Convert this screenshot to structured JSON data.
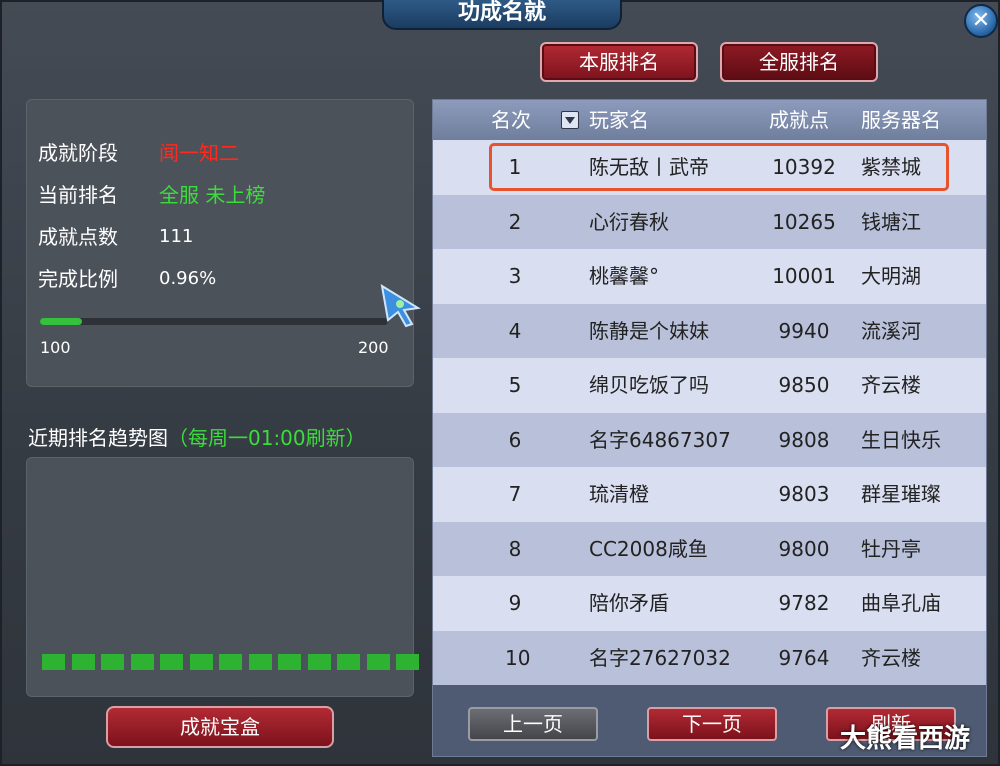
{
  "window": {
    "title": "功成名就",
    "close": "✕"
  },
  "tabs": {
    "server_rank": "本服排名",
    "all_rank": "全服排名"
  },
  "info": {
    "stage_label": "成就阶段",
    "stage_value": "闻一知二",
    "rank_label": "当前排名",
    "rank_value": "全服 未上榜",
    "points_label": "成就点数",
    "points_value": "111",
    "ratio_label": "完成比例",
    "ratio_value": "0.96%",
    "progress_fraction": 0.12,
    "scale_min": "100",
    "scale_max": "200"
  },
  "trend": {
    "title": "近期排名趋势图",
    "note": "（每周一01:00刷新）",
    "bar_count": 13
  },
  "table": {
    "headers": {
      "rank": "名次",
      "player": "玩家名",
      "points": "成就点",
      "server": "服务器名"
    },
    "rows": [
      {
        "rank": "1",
        "player": "陈无敌丨武帝",
        "points": "10392",
        "server": "紫禁城"
      },
      {
        "rank": "2",
        "player": "心衍春秋",
        "points": "10265",
        "server": "钱塘江"
      },
      {
        "rank": "3",
        "player": "桃馨馨°",
        "points": "10001",
        "server": "大明湖"
      },
      {
        "rank": "4",
        "player": "陈静是个妹妹",
        "points": "9940",
        "server": "流溪河"
      },
      {
        "rank": "5",
        "player": "绵贝吃饭了吗",
        "points": "9850",
        "server": "齐云楼"
      },
      {
        "rank": "6",
        "player": "名字64867307",
        "points": "9808",
        "server": "生日快乐"
      },
      {
        "rank": "7",
        "player": "琉清橙",
        "points": "9803",
        "server": "群星璀璨"
      },
      {
        "rank": "8",
        "player": "CC2008咸鱼",
        "points": "9800",
        "server": "牡丹亭"
      },
      {
        "rank": "9",
        "player": "陪你矛盾",
        "points": "9782",
        "server": "曲阜孔庙"
      },
      {
        "rank": "10",
        "player": "名字27627032",
        "points": "9764",
        "server": "齐云楼"
      }
    ]
  },
  "buttons": {
    "treasure": "成就宝盒",
    "prev": "上一页",
    "next": "下一页",
    "refresh": "刷新"
  },
  "watermark": "大熊看西游",
  "colors": {
    "stage": "#ff2a1f",
    "rank": "#3cdc3c",
    "trend_note": "#3cdc3c",
    "highlight": "#e7532d"
  },
  "icons": {
    "cursor": "game-cursor-icon",
    "sort": "dropdown-arrow-icon"
  }
}
